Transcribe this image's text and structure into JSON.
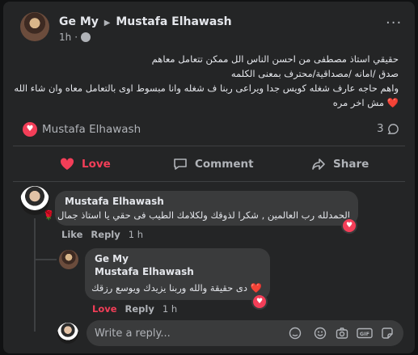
{
  "post": {
    "author": "Ge My",
    "target": "Mustafa Elhawash",
    "time": "1h",
    "more_icon": "ellipsis-icon",
    "lines": [
      "حقيقي استاذ مصطفى من احسن الناس الل ممكن تتعامل معاهم",
      "صدق /امانه /مصداقية/محترف بمعنى الكلمه",
      "واهم حاجه عارف شغله كويس جدا ويراعى ربنا ف شغله وانا مبسوط اوى بالتعامل معاه وان شاء الله",
      "مش اخر مره"
    ],
    "reactions_label": "Mustafa Elhawash",
    "comments_count": "3"
  },
  "actions": {
    "love": "Love",
    "comment": "Comment",
    "share": "Share"
  },
  "comments": [
    {
      "author": "Mustafa Elhawash",
      "text": "الحمدلله رب العالمين , شكرا لذوقك ولكلامك الطيب فى حقي يا استاذ جمال 🌹",
      "like": "Like",
      "reply": "Reply",
      "time": "1 h"
    }
  ],
  "reply": {
    "author_line1": "Ge My",
    "author_line2": "Mustafa Elhawash",
    "text": "دى حقيقة والله وربنا يزيدك ويوسع رزقك",
    "love": "Love",
    "reply": "Reply",
    "time": "1 h"
  },
  "composer": {
    "placeholder": "Write a reply...",
    "icons": [
      "smiley-icon",
      "camera-icon",
      "gif-icon",
      "sticker-icon",
      "avatar-sticker-icon"
    ]
  },
  "colors": {
    "accent_love": "#f33e58",
    "background": "#242526",
    "bubble": "#3a3b3c"
  }
}
